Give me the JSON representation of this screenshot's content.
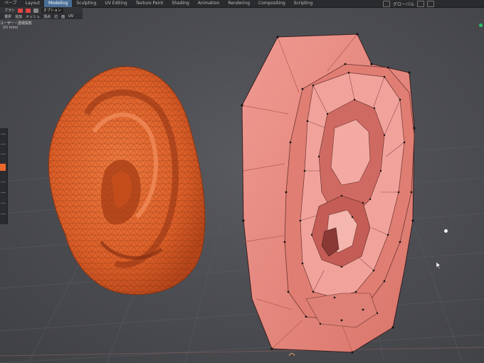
{
  "topbar": {
    "tabs": [
      {
        "label": "ペーブ"
      },
      {
        "label": "Layout"
      },
      {
        "label": "Modeling",
        "active": true
      },
      {
        "label": "Sculpting"
      },
      {
        "label": "UV Editing"
      },
      {
        "label": "Texture Paint"
      },
      {
        "label": "Shading"
      },
      {
        "label": "Animation"
      },
      {
        "label": "Rendering"
      },
      {
        "label": "Compositing"
      },
      {
        "label": "Scripting"
      }
    ],
    "transform_orientation": "グローバル"
  },
  "toolbar": {
    "brush_label": "ブラシ",
    "options_label": "オプション"
  },
  "menubar": {
    "items": [
      "選択",
      "追加",
      "メッシュ",
      "頂点",
      "辺",
      "面",
      "UV"
    ]
  },
  "panel": {
    "mode_title": "ユーザー・透視投影",
    "mode_sub": "(0) mimi"
  },
  "colors": {
    "viewport_bg": "#4a4b50",
    "active_tab": "#4a6f96",
    "sculpt_mesh": "#e0642e",
    "lowpoly_mesh": "#e48a7e",
    "status": "#2fbf6f"
  },
  "objects": [
    {
      "name": "high-poly sculpted ear"
    },
    {
      "name": "low-poly retopology ear"
    }
  ]
}
